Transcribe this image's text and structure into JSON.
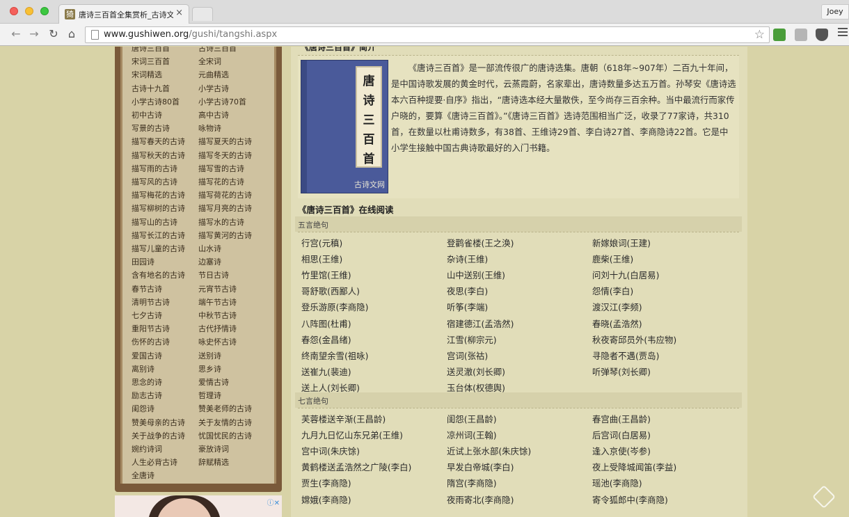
{
  "browser": {
    "tab_title": "唐诗三百首全集赏析_古诗文网",
    "tab_close": "×",
    "profile_name": "Joey",
    "url_domain": "www.gushiwen.org",
    "url_path": "/gushi/tangshi.aspx",
    "nav": {
      "back": "←",
      "forward": "→",
      "reload": "↻",
      "home": "⌂"
    },
    "star": "☆",
    "favicon_char": "猗"
  },
  "sidebar": {
    "categories": [
      [
        "唐诗三百首",
        "古诗三百首"
      ],
      [
        "宋词三百首",
        "全宋词"
      ],
      [
        "宋词精选",
        "元曲精选"
      ],
      [
        "古诗十九首",
        "小学古诗"
      ],
      [
        "小学古诗80首",
        "小学古诗70首"
      ],
      [
        "初中古诗",
        "高中古诗"
      ],
      [
        "写景的古诗",
        "咏物诗"
      ],
      [
        "描写春天的古诗",
        "描写夏天的古诗"
      ],
      [
        "描写秋天的古诗",
        "描写冬天的古诗"
      ],
      [
        "描写雨的古诗",
        "描写雪的古诗"
      ],
      [
        "描写风的古诗",
        "描写花的古诗"
      ],
      [
        "描写梅花的古诗",
        "描写荷花的古诗"
      ],
      [
        "描写柳树的古诗",
        "描写月亮的古诗"
      ],
      [
        "描写山的古诗",
        "描写水的古诗"
      ],
      [
        "描写长江的古诗",
        "描写黄河的古诗"
      ],
      [
        "描写儿童的古诗",
        "山水诗"
      ],
      [
        "田园诗",
        "边塞诗"
      ],
      [
        "含有地名的古诗",
        "节日古诗"
      ],
      [
        "春节古诗",
        "元宵节古诗"
      ],
      [
        "清明节古诗",
        "端午节古诗"
      ],
      [
        "七夕古诗",
        "中秋节古诗"
      ],
      [
        "重阳节古诗",
        "古代抒情诗"
      ],
      [
        "伤怀的古诗",
        "咏史怀古诗"
      ],
      [
        "爱国古诗",
        "送别诗"
      ],
      [
        "离别诗",
        "思乡诗"
      ],
      [
        "思念的诗",
        "爱情古诗"
      ],
      [
        "励志古诗",
        "哲理诗"
      ],
      [
        "闺怨诗",
        "赞美老师的古诗"
      ],
      [
        "赞美母亲的古诗",
        "关于友情的古诗"
      ],
      [
        "关于战争的古诗",
        "忧国忧民的古诗"
      ],
      [
        "婉约诗词",
        "豪放诗词"
      ],
      [
        "人生必背古诗",
        "辞赋精选"
      ],
      [
        "全唐诗",
        ""
      ]
    ]
  },
  "ad": {
    "logo": "ⓘ✕"
  },
  "main": {
    "intro_title": "《唐诗三百首》简介",
    "cover_title": [
      "唐",
      "诗",
      "三",
      "百",
      "首"
    ],
    "cover_brand": "古诗文网",
    "intro_text": "《唐诗三百首》是一部流传很广的唐诗选集。唐朝（618年~907年）二百九十年间，是中国诗歌发展的黄金时代，云蒸霞蔚，名家辈出，唐诗数量多达五万首。孙琴安《唐诗选本六百种提要·自序》指出，“唐诗选本经大量散佚，至今尚存三百余种。当中最流行而家传户晓的，要算《唐诗三百首》。”《唐诗三百首》选诗范围相当广泛，收录了77家诗，共310首，在数量以杜甫诗数多，有38首、王维诗29首、李白诗27首、李商隐诗22首。它是中小学生接触中国古典诗歌最好的入门书籍。",
    "online_title": "《唐诗三百首》在线阅读",
    "sections": [
      {
        "heading": "五言绝句",
        "poems": [
          "行宫(元稹)",
          "登鹳雀楼(王之涣)",
          "新嫁娘词(王建)",
          "相思(王维)",
          "杂诗(王维)",
          "鹿柴(王维)",
          "竹里馆(王维)",
          "山中送别(王维)",
          "问刘十九(白居易)",
          "哥舒歌(西鄙人)",
          "夜思(李白)",
          "怨情(李白)",
          "登乐游原(李商隐)",
          "听筝(李端)",
          "渡汉江(李频)",
          "八阵图(杜甫)",
          "宿建德江(孟浩然)",
          "春晓(孟浩然)",
          "春怨(金昌绪)",
          "江雪(柳宗元)",
          "秋夜寄邱员外(韦应物)",
          "终南望余雪(祖咏)",
          "宫词(张祜)",
          "寻隐者不遇(贾岛)",
          "送崔九(裴迪)",
          "送灵澈(刘长卿)",
          "听弹琴(刘长卿)",
          "送上人(刘长卿)",
          "玉台体(权德舆)",
          ""
        ]
      },
      {
        "heading": "七言绝句",
        "poems": [
          "芙蓉楼送辛渐(王昌龄)",
          "闺怨(王昌龄)",
          "春宫曲(王昌龄)",
          "九月九日忆山东兄弟(王维)",
          "凉州词(王翰)",
          "后宫词(白居易)",
          "宫中词(朱庆馀)",
          "近试上张水部(朱庆馀)",
          "逢入京使(岑参)",
          "黄鹤楼送孟浩然之广陵(李白)",
          "早发白帝城(李白)",
          "夜上受降城闻笛(李益)",
          "贾生(李商隐)",
          "隋宫(李商隐)",
          "瑶池(李商隐)",
          "嫦娥(李商隐)",
          "夜雨寄北(李商隐)",
          "寄令狐郎中(李商隐)"
        ]
      }
    ]
  },
  "colors": {
    "page_bg": "#d8d3a7",
    "panel_wood": "#7a5a3a",
    "main_bg": "#e1ddb9",
    "cover_blue": "#4a5a9a"
  },
  "icons": [
    "traffic-light-icons",
    "back-icon",
    "forward-icon",
    "reload-icon",
    "home-icon",
    "star-icon",
    "menu-icon"
  ]
}
